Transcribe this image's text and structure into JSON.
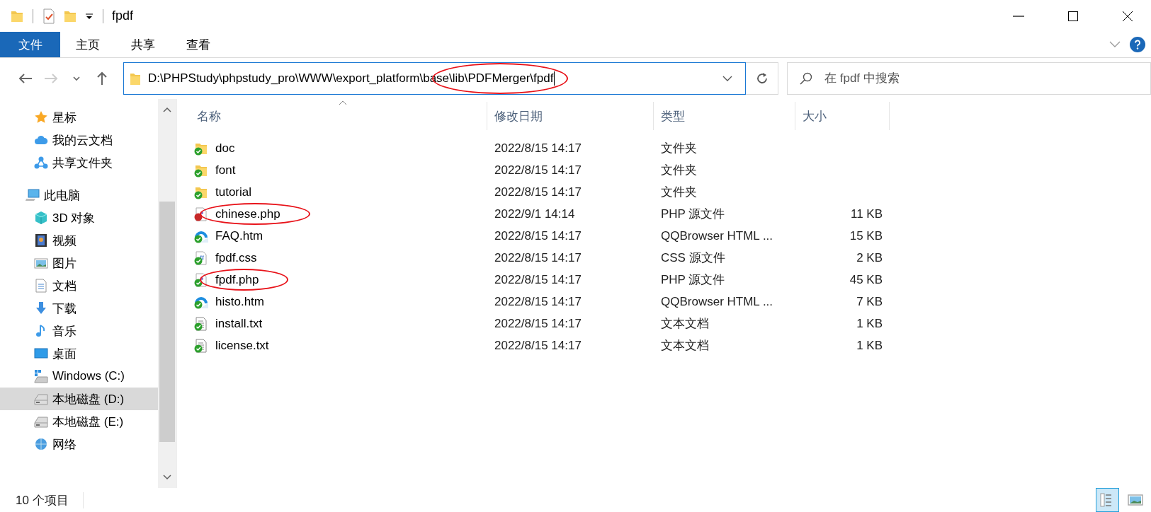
{
  "window": {
    "title": "fpdf"
  },
  "ribbon_tabs": [
    {
      "label": "文件",
      "kind": "file",
      "selected": false
    },
    {
      "label": "主页",
      "kind": "tab",
      "selected": false
    },
    {
      "label": "共享",
      "kind": "tab",
      "selected": false
    },
    {
      "label": "查看",
      "kind": "tab",
      "selected": false
    }
  ],
  "address_bar": {
    "path": "D:\\PHPStudy\\phpstudy_pro\\WWW\\export_platform\\base\\lib\\PDFMerger\\fpdf",
    "focused": true,
    "circled": true
  },
  "search": {
    "placeholder": "在 fpdf 中搜索"
  },
  "sidebar": {
    "items": [
      {
        "label": "星标",
        "kind": "star",
        "selected": false
      },
      {
        "label": "我的云文档",
        "kind": "cloud",
        "selected": false
      },
      {
        "label": "共享文件夹",
        "kind": "share",
        "selected": false
      },
      {
        "label": "此电脑",
        "kind": "computer",
        "selected": false,
        "children": [
          {
            "label": "3D 对象",
            "kind": "cube",
            "selected": false
          },
          {
            "label": "视频",
            "kind": "film",
            "selected": false
          },
          {
            "label": "图片",
            "kind": "picture",
            "selected": false
          },
          {
            "label": "文档",
            "kind": "document",
            "selected": false
          },
          {
            "label": "下载",
            "kind": "download",
            "selected": false
          },
          {
            "label": "音乐",
            "kind": "music",
            "selected": false
          },
          {
            "label": "桌面",
            "kind": "desktop",
            "selected": false
          },
          {
            "label": "Windows (C:)",
            "kind": "sysdrive",
            "selected": false
          },
          {
            "label": "本地磁盘 (D:)",
            "kind": "drive",
            "selected": true
          },
          {
            "label": "本地磁盘 (E:)",
            "kind": "drive",
            "selected": false
          }
        ]
      },
      {
        "label": "网络",
        "kind": "network",
        "selected": false
      }
    ]
  },
  "table": {
    "columns": [
      {
        "label": "名称",
        "sorted": true
      },
      {
        "label": "修改日期",
        "sorted": false
      },
      {
        "label": "类型",
        "sorted": false
      },
      {
        "label": "大小",
        "sorted": false
      }
    ],
    "rows": [
      {
        "name": "doc",
        "modified": "2022/8/15 14:17",
        "type": "文件夹",
        "kind": "folder",
        "sync_error": false,
        "circled": false
      },
      {
        "name": "font",
        "modified": "2022/8/15 14:17",
        "type": "文件夹",
        "kind": "folder",
        "sync_error": false,
        "circled": false
      },
      {
        "name": "tutorial",
        "modified": "2022/8/15 14:17",
        "type": "文件夹",
        "kind": "folder",
        "sync_error": false,
        "circled": false
      },
      {
        "name": "chinese.php",
        "modified": "2022/9/1 14:14",
        "type": "PHP 源文件",
        "size": "11 KB",
        "kind": "php",
        "sync_error": true,
        "circled": true
      },
      {
        "name": "FAQ.htm",
        "modified": "2022/8/15 14:17",
        "type": "QQBrowser HTML ...",
        "size": "15 KB",
        "kind": "web",
        "sync_error": false,
        "circled": false
      },
      {
        "name": "fpdf.css",
        "modified": "2022/8/15 14:17",
        "type": "CSS 源文件",
        "size": "2 KB",
        "kind": "css",
        "sync_error": false,
        "circled": false
      },
      {
        "name": "fpdf.php",
        "modified": "2022/8/15 14:17",
        "type": "PHP 源文件",
        "size": "45 KB",
        "kind": "php",
        "sync_error": false,
        "circled": true
      },
      {
        "name": "histo.htm",
        "modified": "2022/8/15 14:17",
        "type": "QQBrowser HTML ...",
        "size": "7 KB",
        "kind": "web",
        "sync_error": false,
        "circled": false
      },
      {
        "name": "install.txt",
        "modified": "2022/8/15 14:17",
        "type": "文本文档",
        "size": "1 KB",
        "kind": "text",
        "sync_error": false,
        "circled": false
      },
      {
        "name": "license.txt",
        "modified": "2022/8/15 14:17",
        "type": "文本文档",
        "size": "1 KB",
        "kind": "text",
        "sync_error": false,
        "circled": false
      }
    ]
  },
  "status_bar": {
    "count": "10 个项目"
  },
  "view_buttons": [
    {
      "kind": "details",
      "selected": true
    },
    {
      "kind": "thumbnails",
      "selected": false
    }
  ]
}
